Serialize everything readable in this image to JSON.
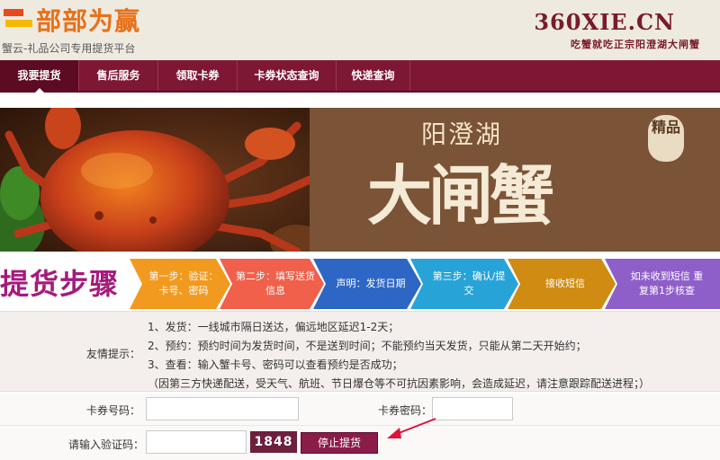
{
  "header": {
    "logo_text": "部部为赢",
    "slogan": "蟹云-礼品公司专用提货平台",
    "site_url": "360XIE.CN",
    "site_tagline": "吃蟹就吃正宗阳澄湖大闸蟹"
  },
  "nav": {
    "items": [
      {
        "label": "我要提货",
        "active": true
      },
      {
        "label": "售后服务",
        "active": false
      },
      {
        "label": "领取卡券",
        "active": false
      },
      {
        "label": "卡券状态查询",
        "active": false
      },
      {
        "label": "快递查询",
        "active": false
      }
    ]
  },
  "banner": {
    "subtitle": "阳澄湖",
    "title": "大闸蟹",
    "seal": "精品"
  },
  "steps": {
    "title": "提货步骤",
    "items": [
      {
        "label": "第一步：验证：卡号、密码",
        "color": "#f29a1f"
      },
      {
        "label": "第二步：填写送货信息",
        "color": "#f0604b"
      },
      {
        "label": "声明：发货日期",
        "color": "#2d66c4"
      },
      {
        "label": "第三步：确认/提交",
        "color": "#28a3d8"
      },
      {
        "label": "接收短信",
        "color": "#d08b12"
      },
      {
        "label": "如未收到短信 重复第1步核查",
        "color": "#8e5fc9"
      }
    ]
  },
  "tips": {
    "label": "友情提示：",
    "lines": [
      "1、发货：一线城市隔日送达，偏远地区延迟1-2天；",
      "2、预约：预约时间为发货时间，不是送到时间；不能预约当天发货，只能从第二天开始约；",
      "3、查看：输入蟹卡号、密码可以查看预约是否成功；",
      "（因第三方快递配送，受天气、航班、节日爆仓等不可抗因素影响，会造成延迟，请注意跟踪配送进程；）"
    ]
  },
  "form": {
    "card_number_label": "卡券号码：",
    "card_number_value": "",
    "card_password_label": "卡券密码：",
    "card_password_value": "",
    "captcha_label": "请输入验证码：",
    "captcha_value": "",
    "captcha_code": "1848",
    "submit_label": "停止提货"
  },
  "colors": {
    "nav_bg": "#7e1734",
    "accent": "#8a1c4a",
    "arrow": "#e0103a"
  }
}
